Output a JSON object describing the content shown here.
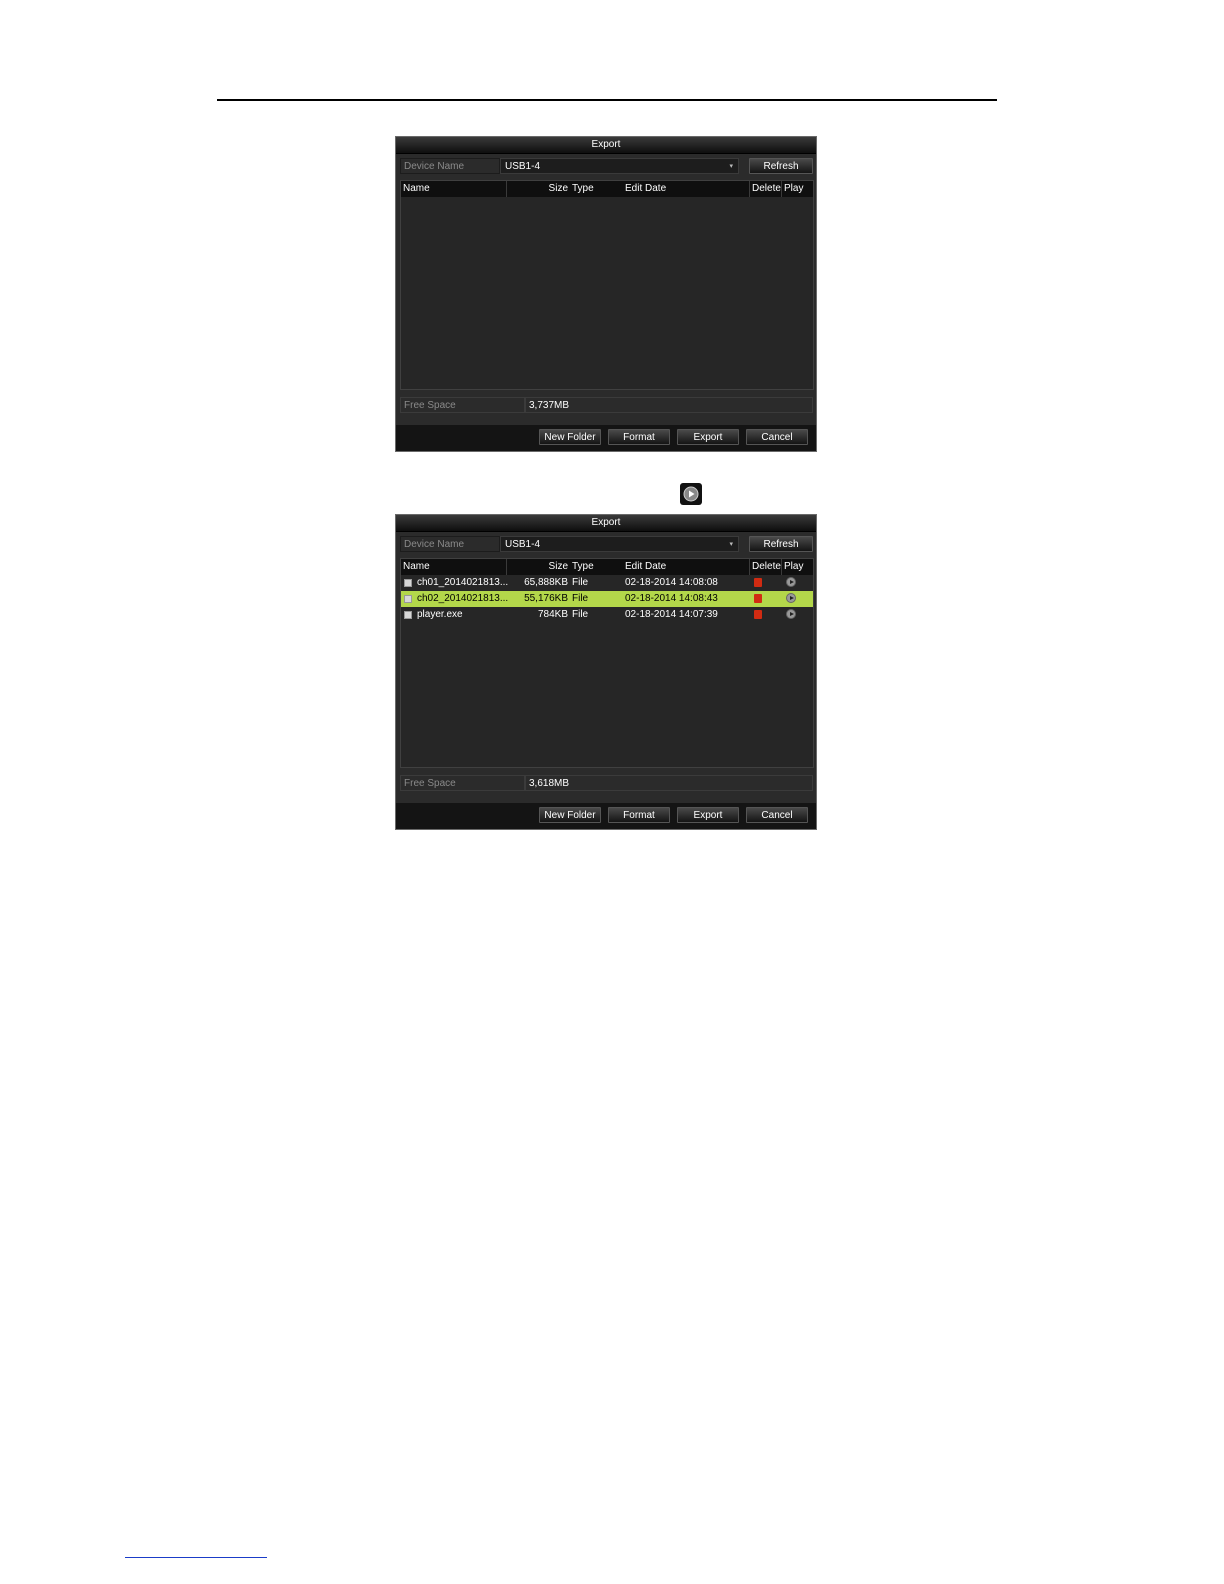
{
  "dialogs": [
    {
      "title": "Export",
      "device_name_label": "Device Name",
      "device_name_value": "USB1-4",
      "refresh_label": "Refresh",
      "columns": {
        "name": "Name",
        "size": "Size",
        "type": "Type",
        "edit_date": "Edit Date",
        "delete": "Delete",
        "play": "Play"
      },
      "rows": [],
      "free_space_label": "Free Space",
      "free_space_value": "3,737MB",
      "buttons": {
        "new_folder": "New Folder",
        "format": "Format",
        "export": "Export",
        "cancel": "Cancel"
      }
    },
    {
      "title": "Export",
      "device_name_label": "Device Name",
      "device_name_value": "USB1-4",
      "refresh_label": "Refresh",
      "columns": {
        "name": "Name",
        "size": "Size",
        "type": "Type",
        "edit_date": "Edit Date",
        "delete": "Delete",
        "play": "Play"
      },
      "rows": [
        {
          "name": "ch01_2014021813...",
          "size": "65,888KB",
          "type": "File",
          "edit_date": "02-18-2014 14:08:08",
          "selected": false
        },
        {
          "name": "ch02_2014021813...",
          "size": "55,176KB",
          "type": "File",
          "edit_date": "02-18-2014 14:08:43",
          "selected": true
        },
        {
          "name": "player.exe",
          "size": "784KB",
          "type": "File",
          "edit_date": "02-18-2014 14:07:39",
          "selected": false
        }
      ],
      "free_space_label": "Free Space",
      "free_space_value": "3,618MB",
      "buttons": {
        "new_folder": "New Folder",
        "format": "Format",
        "export": "Export",
        "cancel": "Cancel"
      }
    }
  ],
  "icons": {
    "inline_play": "play-circle-icon",
    "delete": "trash-icon",
    "play": "play-icon"
  },
  "colors": {
    "selected_row": "#b3d74a",
    "delete_icon": "#d12b12",
    "dialog_bg": "#2b2b2b"
  }
}
